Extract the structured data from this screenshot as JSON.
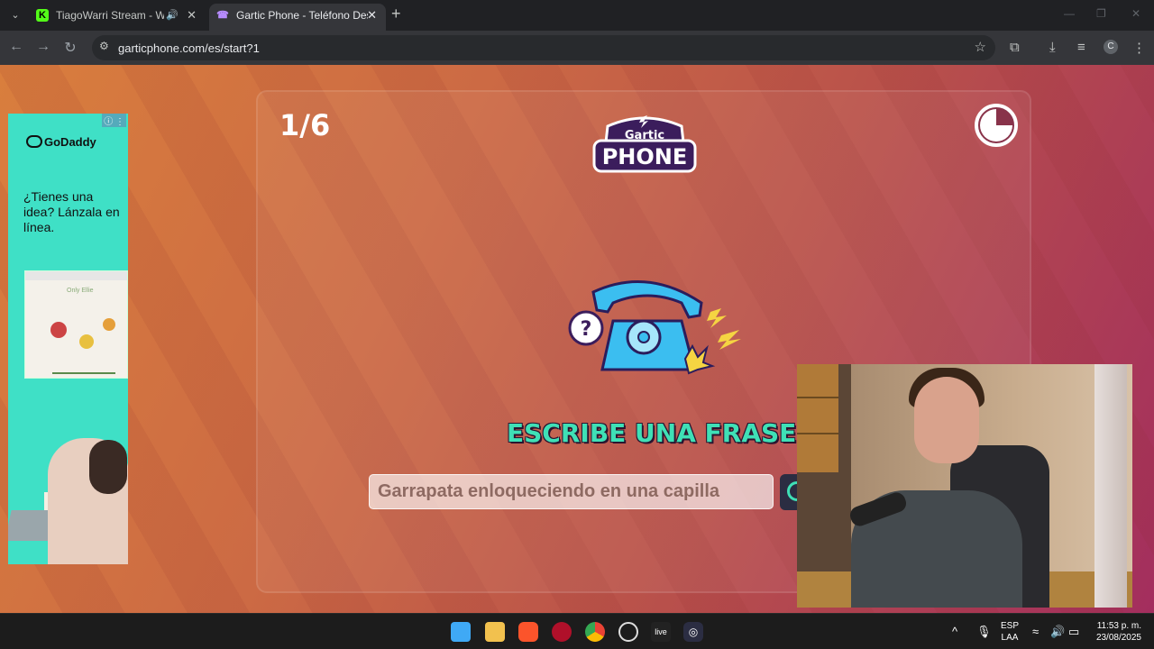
{
  "browser": {
    "tabs": [
      {
        "title": "TiagoWarri Stream - Watch",
        "favicon": "kick-icon"
      },
      {
        "title": "Gartic Phone - Teléfono Descon",
        "favicon": "gartic-phone-icon"
      }
    ],
    "url": "garticphone.com/es/start?1",
    "profile_initial": "C"
  },
  "ad": {
    "brand": "GoDaddy",
    "headline": "¿Tienes una idea? Lánzala en línea.",
    "mockup_title": "Only Ellie"
  },
  "game": {
    "round": "1/6",
    "logo_line1": "Gartic",
    "logo_line2": "PHONE",
    "prompt": "ESCRIBE UNA FRASE",
    "input_value": "Garrapata enloqueciendo en una capilla"
  },
  "taskbar": {
    "language_line1": "ESP",
    "language_line2": "LAA",
    "time": "11:53 p. m.",
    "date": "23/08/2025",
    "icons": [
      "windows-start-icon",
      "file-explorer-icon",
      "brave-icon",
      "app-icon",
      "chrome-icon",
      "obs-icon",
      "live-icon",
      "app-active-icon"
    ]
  },
  "colors": {
    "prompt_text": "#3fe0b6",
    "ad_background": "#3fe0c6",
    "page_gradient_start": "#d97e3d",
    "page_gradient_end": "#a32e5e"
  }
}
